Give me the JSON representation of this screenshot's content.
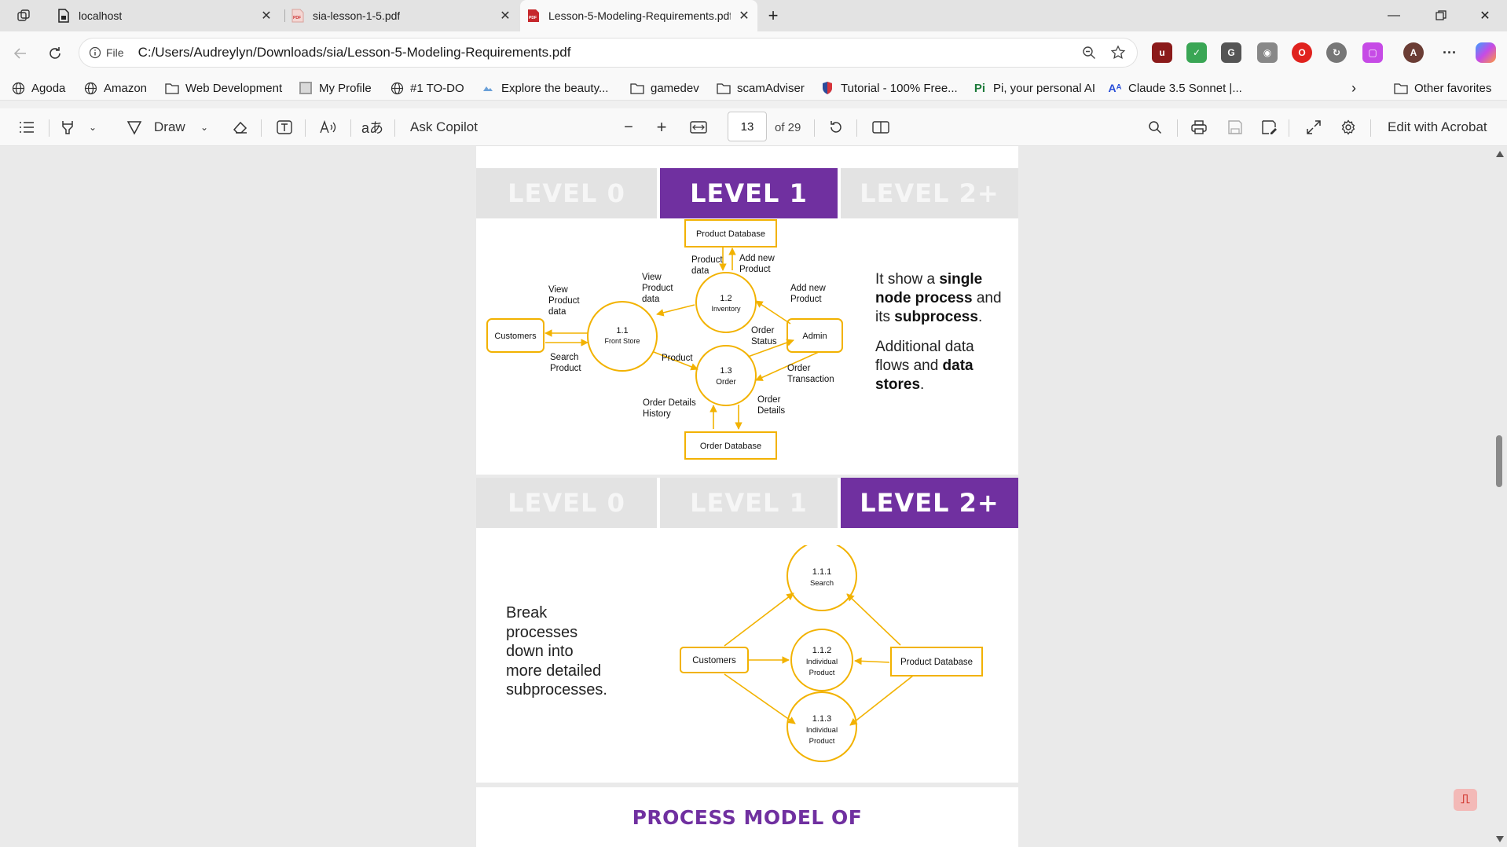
{
  "tabs": [
    {
      "label": "localhost",
      "icon": "document-lock-icon"
    },
    {
      "label": "sia-lesson-1-5.pdf",
      "icon": "pdf-icon"
    },
    {
      "label": "Lesson-5-Modeling-Requirements.pdf",
      "icon": "pdf-icon"
    }
  ],
  "address": {
    "scheme_label": "File",
    "url": "C:/Users/Audreylyn/Downloads/sia/Lesson-5-Modeling-Requirements.pdf"
  },
  "favorites": [
    {
      "label": "Agoda",
      "icon": "globe-icon"
    },
    {
      "label": "Amazon",
      "icon": "globe-icon"
    },
    {
      "label": "Web Development",
      "icon": "folder-icon"
    },
    {
      "label": "My Profile",
      "icon": "profile-icon"
    },
    {
      "label": "#1 TO-DO",
      "icon": "globe-icon"
    },
    {
      "label": "Explore the beauty...",
      "icon": "page-icon"
    },
    {
      "label": "gamedev",
      "icon": "folder-icon"
    },
    {
      "label": "scamAdviser",
      "icon": "folder-icon"
    },
    {
      "label": "Tutorial - 100% Free...",
      "icon": "shield-icon"
    },
    {
      "label": "Pi, your personal AI",
      "icon": "pi-icon"
    },
    {
      "label": "Claude 3.5 Sonnet |...",
      "icon": "ai-icon"
    }
  ],
  "favorites_other": "Other favorites",
  "toolbar": {
    "draw_label": "Draw",
    "ask_copilot": "Ask Copilot",
    "page_current": "13",
    "page_total": "of 29",
    "edit_acrobat": "Edit with Acrobat"
  },
  "level_tabs_top": [
    "LEVEL 0",
    "LEVEL 1",
    "LEVEL 2+"
  ],
  "level_tabs_bottom": [
    "LEVEL 0",
    "LEVEL 1",
    "LEVEL 2+"
  ],
  "level1": {
    "description": {
      "p1_a": "It show a ",
      "p1_b": "single node process",
      "p1_c": " and its ",
      "p1_d": "subprocess",
      "p1_e": ".",
      "p2_a": "Additional data flows and ",
      "p2_b": "data stores",
      "p2_c": "."
    },
    "diagram": {
      "product_db": "Product Database",
      "order_db": "Order Database",
      "customers": "Customers",
      "admin": "Admin",
      "p11_num": "1.1",
      "p11_name": "Front Store",
      "p12_num": "1.2",
      "p12_name": "Inventory",
      "p13_num": "1.3",
      "p13_name": "Order",
      "l_product_data": [
        "Product",
        "data"
      ],
      "l_add_new_product_top": [
        "Add new",
        "Product"
      ],
      "l_view_product_data_mid": [
        "View",
        "Product",
        "data"
      ],
      "l_view_product_data_left": [
        "View",
        "Product",
        "data"
      ],
      "l_add_new_product_right": [
        "Add new",
        "Product"
      ],
      "l_order_status": [
        "Order",
        "Status"
      ],
      "l_search_product": [
        "Search",
        "Product"
      ],
      "l_product": "Product",
      "l_order_transaction": [
        "Order",
        "Transaction"
      ],
      "l_order_details_history": [
        "Order Details",
        "History"
      ],
      "l_order_details": [
        "Order",
        "Details"
      ]
    }
  },
  "level2": {
    "description": [
      "Break",
      "processes",
      "down into",
      "more detailed",
      "subprocesses."
    ],
    "diagram": {
      "customers": "Customers",
      "product_db": "Product Database",
      "p111": [
        "1.1.1",
        "Search"
      ],
      "p112": [
        "1.1.2",
        "Individual",
        "Product"
      ],
      "p113": [
        "1.1.3",
        "Individual",
        "Product"
      ]
    }
  },
  "next_page_title": "PROCESS MODEL OF",
  "colors": {
    "accent_purple": "#7030a0",
    "diagram_yellow": "#f2b200",
    "tab_off": "#e3e3e3"
  }
}
